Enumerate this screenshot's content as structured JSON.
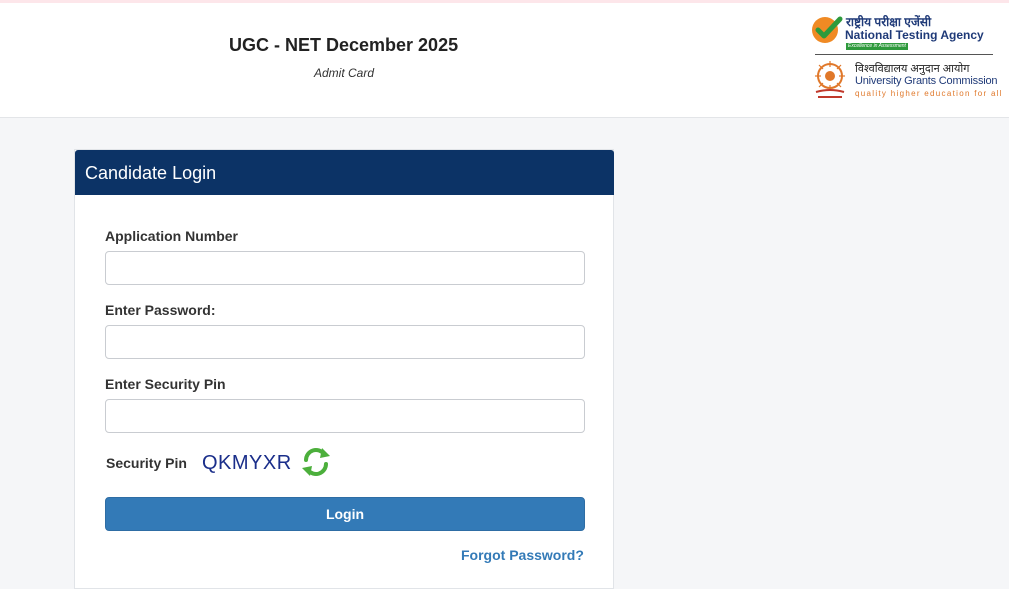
{
  "header": {
    "title": "UGC - NET December 2025",
    "subtitle": "Admit Card",
    "nta": {
      "hindi": "राष्ट्रीय परीक्षा एजेंसी",
      "name": "National Testing Agency",
      "tagline": "Excellence in Assessment"
    },
    "ugc": {
      "hindi": "विश्वविद्यालय अनुदान आयोग",
      "name": "University Grants Commission",
      "tagline": "quality higher education for all"
    }
  },
  "login": {
    "title": "Candidate Login",
    "application_number_label": "Application Number",
    "application_number_value": "",
    "password_label": "Enter Password:",
    "password_value": "",
    "security_pin_label": "Enter Security Pin",
    "security_pin_value": "",
    "captcha_label": "Security Pin",
    "captcha_value": "QKMYXR",
    "refresh_icon": "refresh-icon",
    "login_button": "Login",
    "forgot_password": "Forgot Password?"
  },
  "colors": {
    "card_header": "#0c3366",
    "button": "#337ab7",
    "link": "#337ab7",
    "captcha": "#1a2e8a"
  }
}
